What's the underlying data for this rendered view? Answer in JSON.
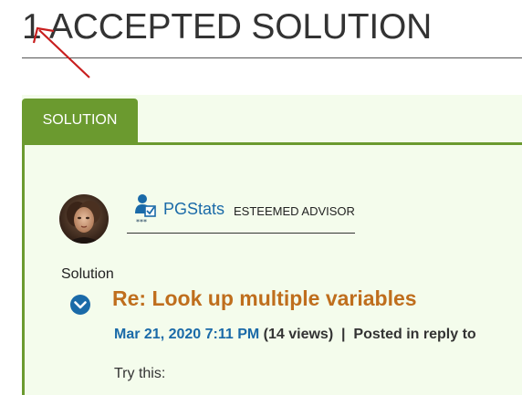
{
  "header": {
    "title": "1 ACCEPTED SOLUTION"
  },
  "tab": {
    "label": "SOLUTION"
  },
  "author": {
    "name": "PGStats",
    "rank": "ESTEEMED ADVISOR"
  },
  "post": {
    "section_label": "Solution",
    "title": "Re: Look up multiple variables",
    "datetime": "Mar 21, 2020 7:11 PM",
    "views": "(14 views)",
    "separator": "|",
    "reply_text": "Posted in reply to",
    "body": "Try this:"
  },
  "colors": {
    "accent_green": "#6b9a2f",
    "panel_bg": "#f4fcec",
    "link_blue": "#1a6aa8",
    "title_orange": "#bf6e1d",
    "annotation_red": "#c81e1e"
  },
  "icons": {
    "annotation": "red-arrow-annotation",
    "avatar": "user-avatar",
    "rank": "esteemed-advisor-rank-icon",
    "expand": "chevron-down-circle-icon"
  }
}
